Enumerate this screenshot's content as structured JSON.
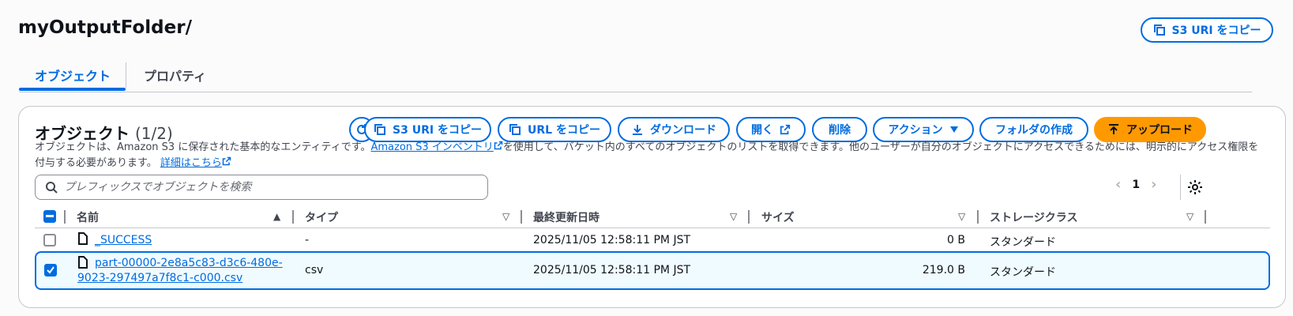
{
  "header": {
    "title": "myOutputFolder/",
    "copy_uri_label": "S3 URI をコピー"
  },
  "tabs": [
    {
      "label": "オブジェクト",
      "active": true
    },
    {
      "label": "プロパティ",
      "active": false
    }
  ],
  "objects_panel": {
    "title": "オブジェクト",
    "count": "(1/2)",
    "actions": {
      "copy_s3_uri": "S3 URI をコピー",
      "copy_url": "URL をコピー",
      "download": "ダウンロード",
      "open": "開く",
      "delete": "削除",
      "actions": "アクション",
      "create_folder": "フォルダの作成",
      "upload": "アップロード"
    },
    "description": {
      "part1": "オブジェクトは、Amazon S3 に保存された基本的なエンティティです。",
      "inventory_link": "Amazon S3 インベントリ",
      "part2": "を使用して、バケット内のすべてのオブジェクトのリストを取得できます。他のユーザーが自分のオブジェクトにアクセスできるためには、明示的にアクセス権限を付与する必要があります。",
      "details_link": "詳細はこちら"
    },
    "search": {
      "placeholder": "プレフィックスでオブジェクトを検索",
      "value": ""
    },
    "pagination": {
      "page": "1"
    },
    "columns": [
      "名前",
      "タイプ",
      "最終更新日時",
      "サイズ",
      "ストレージクラス"
    ],
    "rows": [
      {
        "name": "_SUCCESS",
        "type": "-",
        "modified": "2025/11/05 12:58:11 PM JST",
        "size": "0 B",
        "storage": "スタンダード",
        "selected": false
      },
      {
        "name_line1": "part-00000-2e8a5c83-d3c6-480e-",
        "name_line2": "9023-297497a7f8c1-c000.csv",
        "type": "csv",
        "modified": "2025/11/05 12:58:11 PM JST",
        "size": "219.0 B",
        "storage": "スタンダード",
        "selected": true
      }
    ]
  },
  "colors": {
    "accent": "#006ce0",
    "upload": "#ff9900",
    "text": "#0f141a",
    "selected_row_bg": "#f0fbff"
  }
}
